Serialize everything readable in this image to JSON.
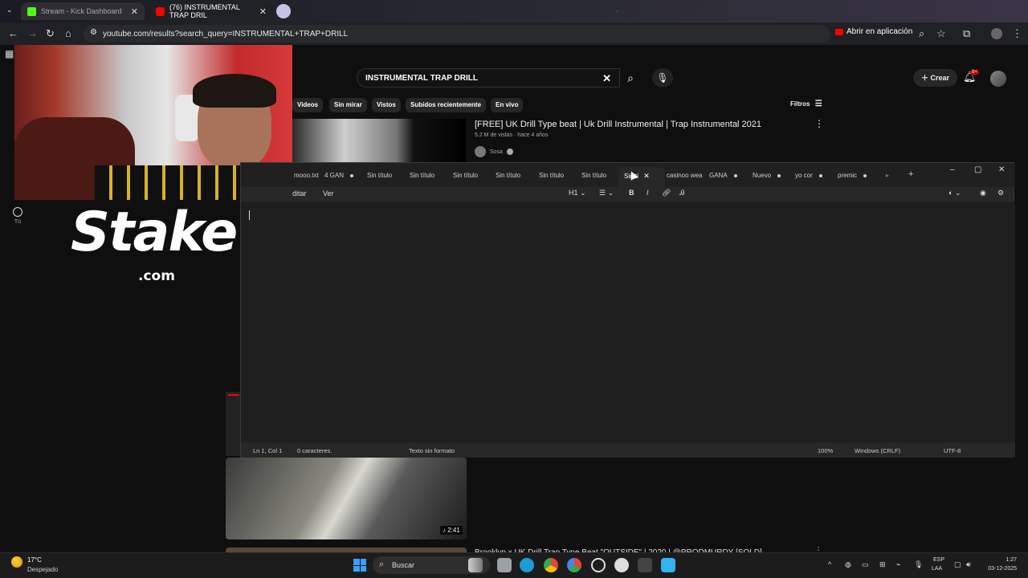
{
  "browser": {
    "tabs": [
      {
        "title": "Stream - Kick Dashboard",
        "icon": "kick-logo-icon",
        "color": "#53fc18"
      },
      {
        "title": "(76) INSTRUMENTAL TRAP DRIL",
        "icon": "youtube-logo-icon",
        "color": "#ff0000"
      }
    ],
    "url": "youtube.com/results?search_query=INSTRUMENTAL+TRAP+DRILL",
    "open_in_app": "Abrir en aplicación"
  },
  "youtube": {
    "search_query": "INSTRUMENTAL TRAP DRILL",
    "create_label": "Crear",
    "notif_badge": "9+",
    "chips": [
      "Videos",
      "Sin mirar",
      "Vistos",
      "Subidos recientemente",
      "En vivo"
    ],
    "filters_label": "Filtros",
    "sidebar_you": "Tú",
    "video1": {
      "title": "[FREE] UK Drill Type beat | Uk Drill Instrumental | Trap Instrumental 2021",
      "meta": "5.2 M de vistas · hace 4 años",
      "channel": "Sosa"
    },
    "video2": {
      "duration": "2:41"
    },
    "video3": {
      "title": "Brooklyn x UK Drill Trap Type Beat \"OUTSIDE\" | 2020 | @PRODMURDY [SOLD]"
    }
  },
  "overlay": {
    "brand_word": "Stake",
    "brand_suffix": ".com"
  },
  "notepad": {
    "tabs": [
      {
        "label": "mooo.txt",
        "dot": false
      },
      {
        "label": "4 GAN",
        "dot": true
      },
      {
        "label": "Sin título",
        "dot": false
      },
      {
        "label": "Sin título",
        "dot": false
      },
      {
        "label": "Sin título",
        "dot": false
      },
      {
        "label": "Sin título",
        "dot": false
      },
      {
        "label": "Sin título",
        "dot": false
      },
      {
        "label": "Sin título",
        "dot": false
      },
      {
        "label": "Sin tí",
        "dot": false,
        "active": true
      },
      {
        "label": "casinoo wea",
        "dot": false
      },
      {
        "label": "GANA",
        "dot": true
      },
      {
        "label": "Nuevo",
        "dot": true
      },
      {
        "label": "yo cor",
        "dot": true
      },
      {
        "label": "premic",
        "dot": true
      }
    ],
    "menu": {
      "edit": "ditar",
      "view": "Ver"
    },
    "format": {
      "heading": "H1",
      "bold": "B",
      "italic": "I"
    },
    "status": {
      "position": "Ln 1, Col 1",
      "chars": "0 caracteres.",
      "format": "Texto sin formato",
      "zoom": "100%",
      "eol": "Windows (CRLF)",
      "encoding": "UTF-8"
    }
  },
  "taskbar": {
    "temperature": "17°C",
    "weather": "Despejado",
    "search_label": "Buscar",
    "lang_top": "ESP",
    "lang_bottom": "LAA",
    "time": "1:27",
    "date": "03-12-2025"
  }
}
